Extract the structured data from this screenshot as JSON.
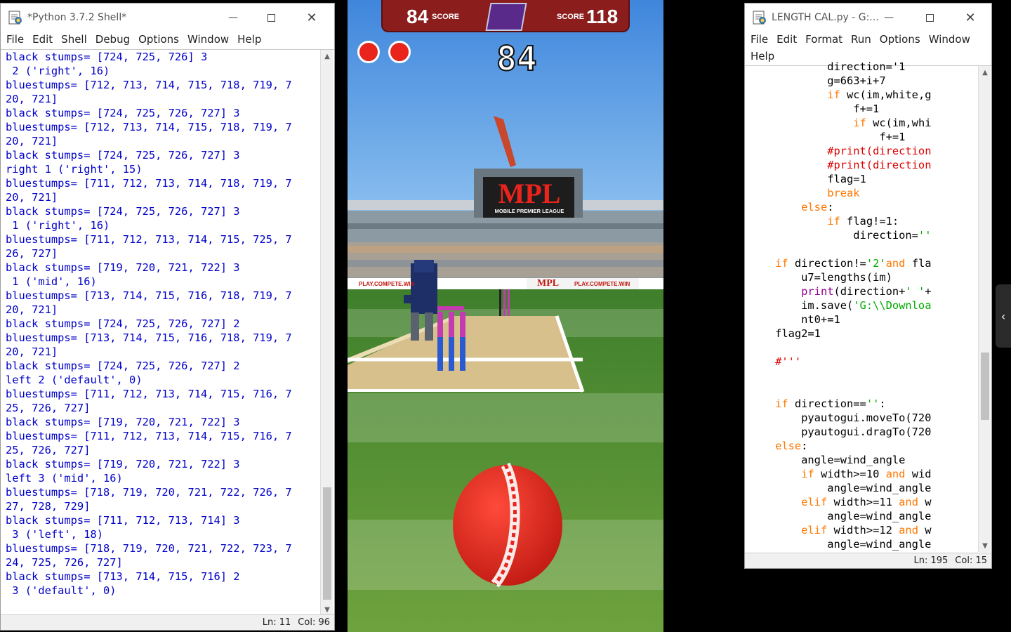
{
  "shell": {
    "title": "*Python 3.7.2 Shell*",
    "menu": [
      "File",
      "Edit",
      "Shell",
      "Debug",
      "Options",
      "Window",
      "Help"
    ],
    "lines": [
      "black stumps= [724, 725, 726] 3",
      " 2 ('right', 16)",
      "bluestumps= [712, 713, 714, 715, 718, 719, 7",
      "20, 721]",
      "black stumps= [724, 725, 726, 727] 3",
      "bluestumps= [712, 713, 714, 715, 718, 719, 7",
      "20, 721]",
      "black stumps= [724, 725, 726, 727] 3",
      "right 1 ('right', 15)",
      "bluestumps= [711, 712, 713, 714, 718, 719, 7",
      "20, 721]",
      "black stumps= [724, 725, 726, 727] 3",
      " 1 ('right', 16)",
      "bluestumps= [711, 712, 713, 714, 715, 725, 7",
      "26, 727]",
      "black stumps= [719, 720, 721, 722] 3",
      " 1 ('mid', 16)",
      "bluestumps= [713, 714, 715, 716, 718, 719, 7",
      "20, 721]",
      "black stumps= [724, 725, 726, 727] 2",
      "bluestumps= [713, 714, 715, 716, 718, 719, 7",
      "20, 721]",
      "black stumps= [724, 725, 726, 727] 2",
      "left 2 ('default', 0)",
      "bluestumps= [711, 712, 713, 714, 715, 716, 7",
      "25, 726, 727]",
      "black stumps= [719, 720, 721, 722] 3",
      "bluestumps= [711, 712, 713, 714, 715, 716, 7",
      "25, 726, 727]",
      "black stumps= [719, 720, 721, 722] 3",
      "left 3 ('mid', 16)",
      "bluestumps= [718, 719, 720, 721, 722, 726, 7",
      "27, 728, 729]",
      "black stumps= [711, 712, 713, 714] 3",
      " 3 ('left', 18)",
      "bluestumps= [718, 719, 720, 721, 722, 723, 7",
      "24, 725, 726, 727]",
      "black stumps= [713, 714, 715, 716] 2",
      " 3 ('default', 0)"
    ],
    "status_ln": "Ln: 11",
    "status_col": "Col: 96"
  },
  "game": {
    "score_left": "84",
    "score_left_label": "SCORE",
    "score_right": "118",
    "score_right_label": "SCORE",
    "current_score": "84",
    "board_brand": "MPL",
    "board_subtitle": "MOBILE PREMIER LEAGUE",
    "ad_text_1": "PLAY.COMPETE.WIN",
    "ad_brand": "MPL",
    "ad_text_2": "PLAY.COMPETE.WIN",
    "balls_remaining": 2,
    "colors": {
      "ball": "#e8241c",
      "scorebar": "#8b1d1d",
      "field": "#5a8e3a",
      "sky": "#4b8fe0"
    }
  },
  "editor": {
    "title": "LENGTH CAL.py - G:...",
    "menu": [
      "File",
      "Edit",
      "Format",
      "Run",
      "Options",
      "Window",
      "Help"
    ],
    "status_ln": "Ln: 195",
    "status_col": "Col: 15",
    "code": [
      [
        {
          "t": "            direction='1",
          "c": "df"
        }
      ],
      [
        {
          "t": "            g=663+i+7",
          "c": "df"
        }
      ],
      [
        {
          "t": "            ",
          "c": "df"
        },
        {
          "t": "if",
          "c": "kw"
        },
        {
          "t": " wc(im,white,g",
          "c": "df"
        }
      ],
      [
        {
          "t": "                f+=1",
          "c": "df"
        }
      ],
      [
        {
          "t": "                ",
          "c": "df"
        },
        {
          "t": "if",
          "c": "kw"
        },
        {
          "t": " wc(im,whi",
          "c": "df"
        }
      ],
      [
        {
          "t": "                    f+=1",
          "c": "df"
        }
      ],
      [
        {
          "t": "            ",
          "c": "df"
        },
        {
          "t": "#print(direction",
          "c": "cm"
        }
      ],
      [
        {
          "t": "            ",
          "c": "df"
        },
        {
          "t": "#print(direction",
          "c": "cm"
        }
      ],
      [
        {
          "t": "            flag=1",
          "c": "df"
        }
      ],
      [
        {
          "t": "            ",
          "c": "df"
        },
        {
          "t": "break",
          "c": "kw"
        }
      ],
      [
        {
          "t": "        ",
          "c": "df"
        },
        {
          "t": "else",
          "c": "kw"
        },
        {
          "t": ":",
          "c": "df"
        }
      ],
      [
        {
          "t": "            ",
          "c": "df"
        },
        {
          "t": "if",
          "c": "kw"
        },
        {
          "t": " flag!=1:",
          "c": "df"
        }
      ],
      [
        {
          "t": "                direction=",
          "c": "df"
        },
        {
          "t": "''",
          "c": "st"
        }
      ],
      [
        {
          "t": "",
          "c": "df"
        }
      ],
      [
        {
          "t": "    ",
          "c": "df"
        },
        {
          "t": "if",
          "c": "kw"
        },
        {
          "t": " direction!=",
          "c": "df"
        },
        {
          "t": "'2'",
          "c": "st"
        },
        {
          "t": "and",
          "c": "kw"
        },
        {
          "t": " fla",
          "c": "df"
        }
      ],
      [
        {
          "t": "        u7=lengths(im)",
          "c": "df"
        }
      ],
      [
        {
          "t": "        ",
          "c": "df"
        },
        {
          "t": "print",
          "c": "bi"
        },
        {
          "t": "(direction+",
          "c": "df"
        },
        {
          "t": "' '",
          "c": "st"
        },
        {
          "t": "+",
          "c": "df"
        }
      ],
      [
        {
          "t": "        im.save(",
          "c": "df"
        },
        {
          "t": "'G:\\\\Downloa",
          "c": "st"
        }
      ],
      [
        {
          "t": "        nt0+=1",
          "c": "df"
        }
      ],
      [
        {
          "t": "    flag2=1",
          "c": "df"
        }
      ],
      [
        {
          "t": "",
          "c": "df"
        }
      ],
      [
        {
          "t": "    ",
          "c": "df"
        },
        {
          "t": "#'''",
          "c": "cm"
        }
      ],
      [
        {
          "t": "",
          "c": "df"
        }
      ],
      [
        {
          "t": "",
          "c": "df"
        }
      ],
      [
        {
          "t": "    ",
          "c": "df"
        },
        {
          "t": "if",
          "c": "kw"
        },
        {
          "t": " direction==",
          "c": "df"
        },
        {
          "t": "''",
          "c": "st"
        },
        {
          "t": ":",
          "c": "df"
        }
      ],
      [
        {
          "t": "        pyautogui.moveTo(720",
          "c": "df"
        }
      ],
      [
        {
          "t": "        pyautogui.dragTo(720",
          "c": "df"
        }
      ],
      [
        {
          "t": "    ",
          "c": "df"
        },
        {
          "t": "else",
          "c": "kw"
        },
        {
          "t": ":",
          "c": "df"
        }
      ],
      [
        {
          "t": "        angle=wind_angle",
          "c": "df"
        }
      ],
      [
        {
          "t": "        ",
          "c": "df"
        },
        {
          "t": "if",
          "c": "kw"
        },
        {
          "t": " width>=10 ",
          "c": "df"
        },
        {
          "t": "and",
          "c": "kw"
        },
        {
          "t": " wid",
          "c": "df"
        }
      ],
      [
        {
          "t": "            angle=wind_angle",
          "c": "df"
        }
      ],
      [
        {
          "t": "        ",
          "c": "df"
        },
        {
          "t": "elif",
          "c": "kw"
        },
        {
          "t": " width>=11 ",
          "c": "df"
        },
        {
          "t": "and",
          "c": "kw"
        },
        {
          "t": " w",
          "c": "df"
        }
      ],
      [
        {
          "t": "            angle=wind_angle",
          "c": "df"
        }
      ],
      [
        {
          "t": "        ",
          "c": "df"
        },
        {
          "t": "elif",
          "c": "kw"
        },
        {
          "t": " width>=12 ",
          "c": "df"
        },
        {
          "t": "and",
          "c": "kw"
        },
        {
          "t": " w",
          "c": "df"
        }
      ],
      [
        {
          "t": "            angle=wind_angle",
          "c": "df"
        }
      ]
    ]
  },
  "side_panel_icon": "chevron-left-icon"
}
